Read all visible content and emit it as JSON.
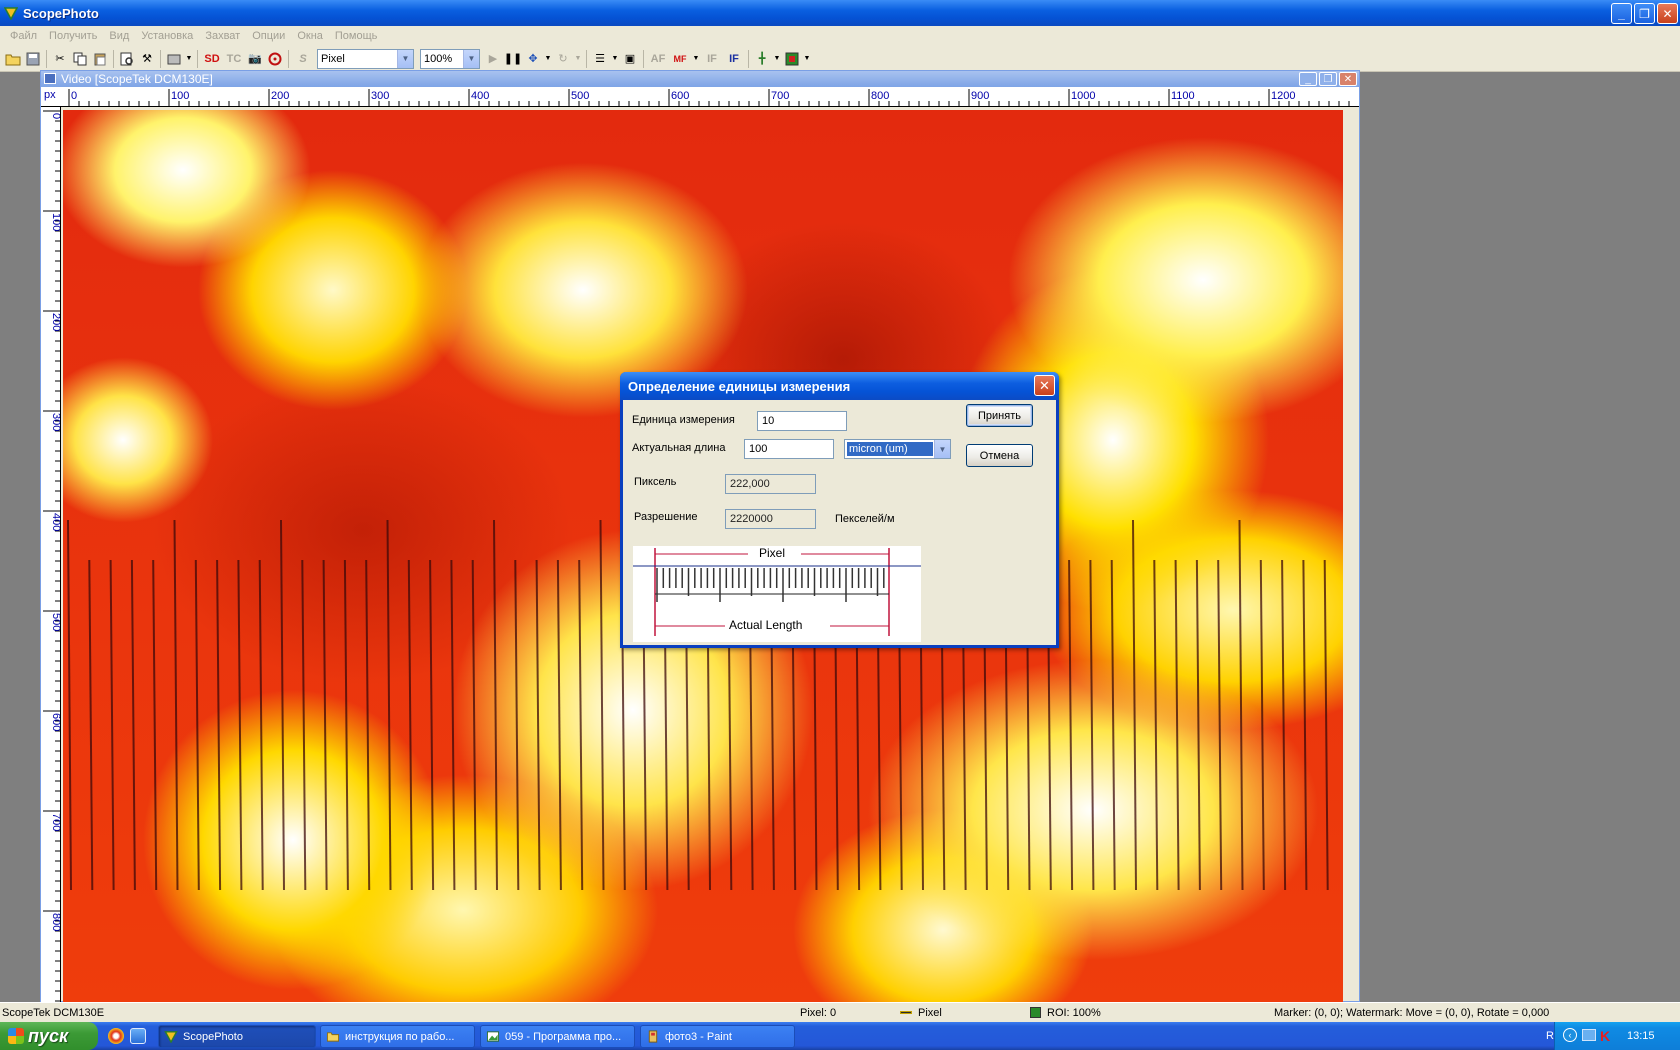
{
  "app": {
    "title": "ScopePhoto"
  },
  "window_buttons": {
    "minimize": "_",
    "restore": "❐",
    "close": "✕"
  },
  "menu": [
    "Файл",
    "Получить",
    "Вид",
    "Установка",
    "Захват",
    "Опции",
    "Окна",
    "Помощь"
  ],
  "toolbar": {
    "sd_label": "SD",
    "tc_label": "TC",
    "s_label": "S",
    "unit_select": "Pixel",
    "zoom_select": "100%",
    "af_label": "AF",
    "mf_label": "MF",
    "if_label": "IF",
    "if_bold_label": "IF"
  },
  "child_window": {
    "title": "Video [ScopeTek DCM130E]",
    "ruler_unit": "px",
    "x_ticks": [
      "0",
      "100",
      "200",
      "300",
      "400",
      "500",
      "600",
      "700",
      "800",
      "900",
      "1000",
      "1100",
      "1200"
    ],
    "y_ticks": [
      "0",
      "100",
      "200",
      "300",
      "400",
      "500",
      "600",
      "700",
      "800"
    ]
  },
  "dialog": {
    "title": "Определение единицы измерения",
    "unit_label": "Единица измерения",
    "unit_value": "10",
    "actual_length_label": "Актуальная длина",
    "actual_length_value": "100",
    "length_unit": "micron (um)",
    "pixel_label": "Пиксель",
    "pixel_value": "222,000",
    "resolution_label": "Разрешение",
    "resolution_value": "2220000",
    "resolution_unit": "Пекселей/м",
    "ok_button": "Принять",
    "cancel_button": "Отмена",
    "illus_pixel": "Pixel",
    "illus_actual": "Actual Length"
  },
  "statusbar": {
    "device": "ScopeTek DCM130E",
    "pixel": "Pixel: 0",
    "unit": "Pixel",
    "roi": "ROI: 100%",
    "marker": "Marker: (0, 0); Watermark: Move = (0, 0), Rotate = 0,000"
  },
  "taskbar": {
    "start": "пуск",
    "tasks": [
      "ScopePhoto",
      "инструкция по рабо...",
      "059 - Программа про...",
      "фото3 - Paint"
    ],
    "lang": "RU",
    "clock": "13:15"
  }
}
